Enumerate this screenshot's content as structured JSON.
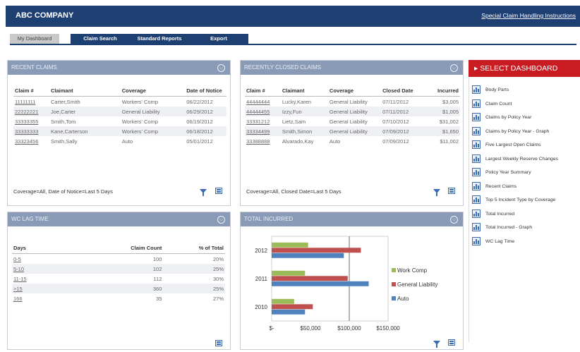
{
  "header": {
    "company": "ABC COMPANY",
    "link": "Special Claim Handling Instructions"
  },
  "tabs": [
    {
      "label": "My Dashboard"
    },
    {
      "label": "Claim Search"
    },
    {
      "label": "Standard Reports"
    },
    {
      "label": "Export"
    }
  ],
  "recent_claims": {
    "title": "RECENT CLAIMS",
    "columns": [
      "Claim #",
      "Claimant",
      "Coverage",
      "Date of Notice"
    ],
    "rows": [
      [
        "11111111",
        "Carter,Smith",
        "Workers' Comp",
        "06/22/2012"
      ],
      [
        "22222221",
        "Joe,Carter",
        "General Liability",
        "06/29/2012"
      ],
      [
        "33333355",
        "Smith,Tom",
        "Workers' Comp",
        "06/19/2012"
      ],
      [
        "33333333",
        "Kane,Carterson",
        "Workers' Comp",
        "06/18/2012"
      ],
      [
        "33323456",
        "Smith,Sally",
        "Auto",
        "05/01/2012"
      ]
    ],
    "filter_text": "Coverage=All, Date of Notice=Last 5 Days"
  },
  "closed_claims": {
    "title": "RECENTLY CLOSED CLAIMS",
    "columns": [
      "Claim #",
      "Claimant",
      "Coverage",
      "Closed Date",
      "Incurred"
    ],
    "rows": [
      [
        "44444444",
        "Lucky,Karen",
        "General Liability",
        "07/11/2012",
        "$3,005"
      ],
      [
        "44444455",
        "Izzy,Fun",
        "General Liability",
        "07/11/2012",
        "$1,005"
      ],
      [
        "33331212",
        "Lietz,Sam",
        "General Liability",
        "07/10/2012",
        "$31,002"
      ],
      [
        "33334499",
        "Smith,Simon",
        "General Liability",
        "07/09/2012",
        "$1,650"
      ],
      [
        "33388888",
        "Alvarado,Kay",
        "Auto",
        "07/09/2012",
        "$11,002"
      ]
    ],
    "filter_text": "Coverage=All, Closed Date=Last 5 Days"
  },
  "wc_lag": {
    "title": "WC LAG TIME",
    "columns": [
      "Days",
      "Claim Count",
      "% of Total"
    ],
    "rows": [
      [
        "0-5",
        "100",
        "20%"
      ],
      [
        "5-10",
        "102",
        "25%"
      ],
      [
        "11-15",
        "112",
        "30%"
      ],
      [
        ">15",
        "360",
        "25%"
      ],
      [
        "166",
        "35",
        "27%"
      ]
    ]
  },
  "total_incurred": {
    "title": "TOTAL INCURRED"
  },
  "chart_data": {
    "type": "bar",
    "orientation": "horizontal",
    "categories": [
      "2012",
      "2011",
      "2010"
    ],
    "series": [
      {
        "name": "Work Comp",
        "color": "#9bbb59",
        "values": [
          47000,
          43000,
          29000
        ]
      },
      {
        "name": "General Liability",
        "color": "#c0504d",
        "values": [
          115000,
          98000,
          53000
        ]
      },
      {
        "name": "Auto",
        "color": "#4f81bd",
        "values": [
          93000,
          125000,
          43000
        ]
      }
    ],
    "xticks": [
      "$-",
      "$50,000",
      "$100,000",
      "$150,000"
    ],
    "xlim": [
      0,
      150000
    ],
    "legend": "right",
    "grid": "vertical gridline at $100,000"
  },
  "select_dashboard": {
    "title": "SELECT DASHBOARD",
    "items": [
      "Body Parts",
      "Claim Count",
      "Claims by Policy Year",
      "Claims by Policy Year - Graph",
      "Five Largest Open Claims",
      "Largest Weekly Reserve Changes",
      "Policy Year Summary",
      "Recent Claims",
      "Top 5 Incident Type by Coverage",
      "Total Incurred",
      "Total Incurred - Graph",
      "WC Lag Time"
    ]
  }
}
